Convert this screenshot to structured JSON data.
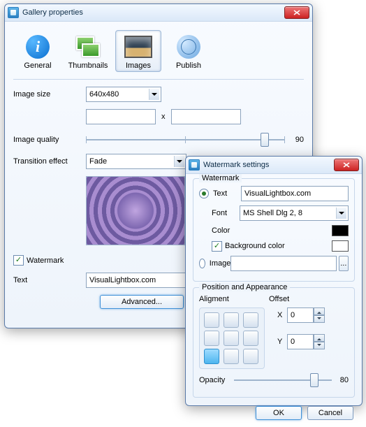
{
  "win1": {
    "title": "Gallery properties",
    "tabs": {
      "general": "General",
      "thumbnails": "Thumbnails",
      "images": "Images",
      "publish": "Publish"
    },
    "labels": {
      "image_size": "Image size",
      "size_x": "x",
      "image_quality": "Image quality",
      "transition_effect": "Transition effect",
      "watermark": "Watermark",
      "text": "Text"
    },
    "values": {
      "image_size": "640x480",
      "image_quality": "90",
      "transition_effect": "Fade",
      "watermark_checked": true,
      "text": "VisualLightbox.com",
      "advanced_btn": "Advanced..."
    }
  },
  "win2": {
    "title": "Watermark settings",
    "group_watermark": "Watermark",
    "group_pa": "Position and Appearance",
    "labels": {
      "text": "Text",
      "font": "Font",
      "color": "Color",
      "bg_color": "Background color",
      "image": "Image",
      "alignment": "Aligment",
      "offset": "Offset",
      "x": "X",
      "y": "Y",
      "opacity": "Opacity",
      "browse": "..."
    },
    "values": {
      "text_selected": true,
      "text": "VisualLightbox.com",
      "font": "MS Shell Dlg 2, 8",
      "color": "#000000",
      "bg_checked": true,
      "bg_color": "#ffffff",
      "image_selected": false,
      "x": "0",
      "y": "0",
      "opacity": "80",
      "align_index": 6
    },
    "buttons": {
      "ok": "OK",
      "cancel": "Cancel"
    }
  }
}
